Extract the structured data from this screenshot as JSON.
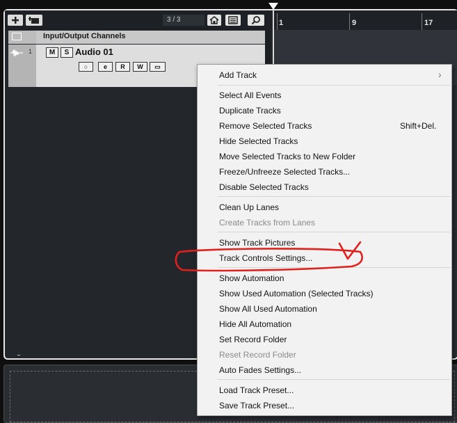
{
  "toolbar": {
    "add_icon": "plus-icon",
    "add_track_type_icon": "add-track-type-icon",
    "track_count": "3 / 3",
    "home_icon": "home-icon",
    "list_icon": "list-icon",
    "search_icon": "search-icon"
  },
  "ruler": {
    "markers": [
      "1",
      "9",
      "17"
    ]
  },
  "tracks": {
    "folder": {
      "title": "Input/Output Channels"
    },
    "audio": {
      "number": "1",
      "name": "Audio 01",
      "mute_label": "M",
      "solo_label": "S",
      "monitor_label": "○",
      "edit_label": "e",
      "read_label": "R",
      "write_label": "W",
      "lanes_label": "▭"
    }
  },
  "bottom_dash": "-",
  "context_menu": {
    "items": [
      {
        "label": "Add Track",
        "enabled": true,
        "submenu": true
      },
      {
        "label": "Select All Events",
        "enabled": true
      },
      {
        "label": "Duplicate Tracks",
        "enabled": true
      },
      {
        "label": "Remove Selected Tracks",
        "enabled": true,
        "shortcut": "Shift+Del."
      },
      {
        "label": "Hide Selected Tracks",
        "enabled": true
      },
      {
        "label": "Move Selected Tracks to New Folder",
        "enabled": true
      },
      {
        "label": "Freeze/Unfreeze Selected Tracks...",
        "enabled": true
      },
      {
        "label": "Disable Selected Tracks",
        "enabled": true
      },
      {
        "label": "Clean Up Lanes",
        "enabled": true
      },
      {
        "label": "Create Tracks from Lanes",
        "enabled": false
      },
      {
        "label": "Show Track Pictures",
        "enabled": true
      },
      {
        "label": "Track Controls Settings...",
        "enabled": true,
        "highlighted_by_annotation": true
      },
      {
        "label": "Show Automation",
        "enabled": true
      },
      {
        "label": "Show Used Automation (Selected Tracks)",
        "enabled": true
      },
      {
        "label": "Show All Used Automation",
        "enabled": true
      },
      {
        "label": "Hide All Automation",
        "enabled": true
      },
      {
        "label": "Set Record Folder",
        "enabled": true
      },
      {
        "label": "Reset Record Folder",
        "enabled": false
      },
      {
        "label": "Auto Fades Settings...",
        "enabled": true
      },
      {
        "label": "Load Track Preset...",
        "enabled": true
      },
      {
        "label": "Save Track Preset...",
        "enabled": true
      }
    ],
    "submenu_arrow": "›"
  },
  "colors": {
    "annotation_red": "#e0201c",
    "menu_background": "#f2f2f2",
    "disabled_text": "#8a8a8a"
  }
}
